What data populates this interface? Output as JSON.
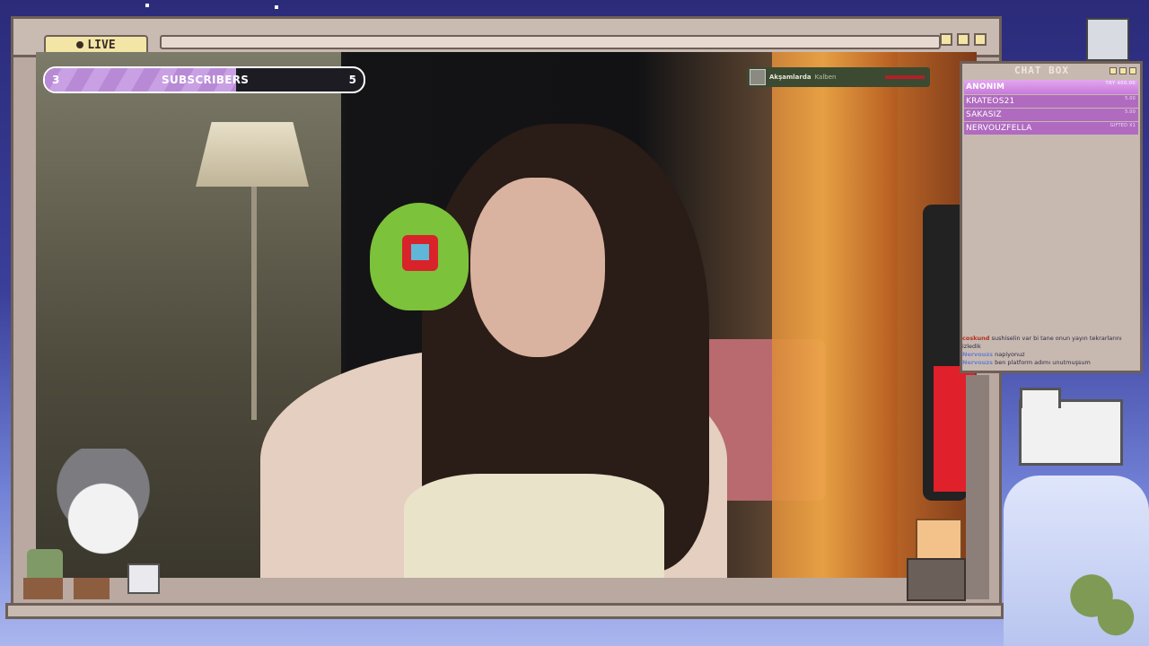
{
  "stream": {
    "live_label": "LIVE"
  },
  "subscribers": {
    "current": "3",
    "label": "SUBSCRIBERS",
    "goal": "5",
    "progress_fraction": 0.6
  },
  "now_playing": {
    "title": "Akşamlarda",
    "artist": "Kalben"
  },
  "chat_box": {
    "title": "CHAT BOX",
    "leaderboard": [
      {
        "name": "ANONIM",
        "amount": "TRY 400.00"
      },
      {
        "name": "KRATEOS21",
        "amount": "5.00"
      },
      {
        "name": "SAKASIZ",
        "amount": "5.00"
      },
      {
        "name": "NERVOUZFELLA",
        "amount": "GIFTED X1"
      }
    ],
    "messages": [
      {
        "user": "coskund",
        "text": "sushiselin var bi tane onun yayın tekrarlarını izledik"
      },
      {
        "user": "Nervouzs",
        "text": "napiyonuz"
      },
      {
        "user": "Nervouzs",
        "text": "ben platform adımı unutmuşsum"
      }
    ]
  },
  "colors": {
    "frame": "#b9a9a0",
    "frame_border": "#6e5f58",
    "live_badge": "#f3e5a6",
    "chat_row": "#b06ac0",
    "subs_fill": "#c9a0e4"
  }
}
